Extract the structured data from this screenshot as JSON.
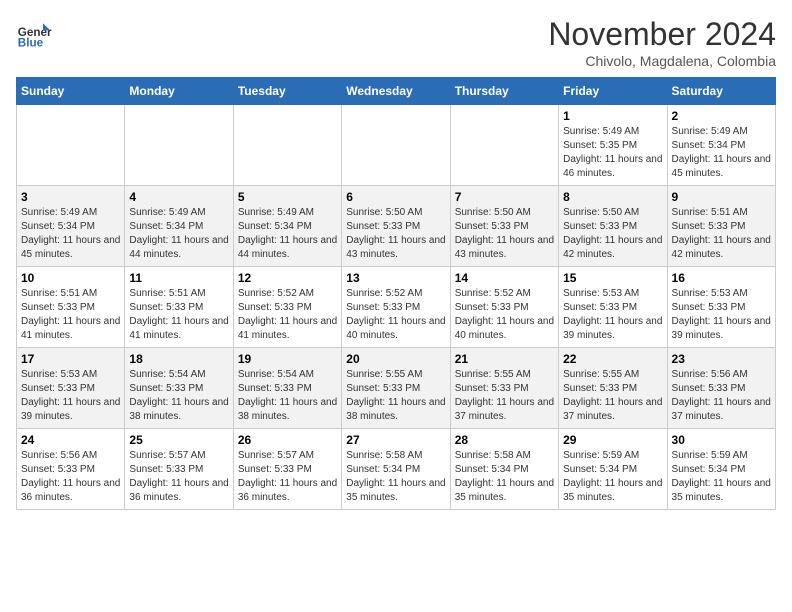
{
  "header": {
    "logo_general": "General",
    "logo_blue": "Blue",
    "month_title": "November 2024",
    "location": "Chivolo, Magdalena, Colombia"
  },
  "calendar": {
    "days_of_week": [
      "Sunday",
      "Monday",
      "Tuesday",
      "Wednesday",
      "Thursday",
      "Friday",
      "Saturday"
    ],
    "weeks": [
      [
        {
          "day": "",
          "info": ""
        },
        {
          "day": "",
          "info": ""
        },
        {
          "day": "",
          "info": ""
        },
        {
          "day": "",
          "info": ""
        },
        {
          "day": "",
          "info": ""
        },
        {
          "day": "1",
          "info": "Sunrise: 5:49 AM\nSunset: 5:35 PM\nDaylight: 11 hours and 46 minutes."
        },
        {
          "day": "2",
          "info": "Sunrise: 5:49 AM\nSunset: 5:34 PM\nDaylight: 11 hours and 45 minutes."
        }
      ],
      [
        {
          "day": "3",
          "info": "Sunrise: 5:49 AM\nSunset: 5:34 PM\nDaylight: 11 hours and 45 minutes."
        },
        {
          "day": "4",
          "info": "Sunrise: 5:49 AM\nSunset: 5:34 PM\nDaylight: 11 hours and 44 minutes."
        },
        {
          "day": "5",
          "info": "Sunrise: 5:49 AM\nSunset: 5:34 PM\nDaylight: 11 hours and 44 minutes."
        },
        {
          "day": "6",
          "info": "Sunrise: 5:50 AM\nSunset: 5:33 PM\nDaylight: 11 hours and 43 minutes."
        },
        {
          "day": "7",
          "info": "Sunrise: 5:50 AM\nSunset: 5:33 PM\nDaylight: 11 hours and 43 minutes."
        },
        {
          "day": "8",
          "info": "Sunrise: 5:50 AM\nSunset: 5:33 PM\nDaylight: 11 hours and 42 minutes."
        },
        {
          "day": "9",
          "info": "Sunrise: 5:51 AM\nSunset: 5:33 PM\nDaylight: 11 hours and 42 minutes."
        }
      ],
      [
        {
          "day": "10",
          "info": "Sunrise: 5:51 AM\nSunset: 5:33 PM\nDaylight: 11 hours and 41 minutes."
        },
        {
          "day": "11",
          "info": "Sunrise: 5:51 AM\nSunset: 5:33 PM\nDaylight: 11 hours and 41 minutes."
        },
        {
          "day": "12",
          "info": "Sunrise: 5:52 AM\nSunset: 5:33 PM\nDaylight: 11 hours and 41 minutes."
        },
        {
          "day": "13",
          "info": "Sunrise: 5:52 AM\nSunset: 5:33 PM\nDaylight: 11 hours and 40 minutes."
        },
        {
          "day": "14",
          "info": "Sunrise: 5:52 AM\nSunset: 5:33 PM\nDaylight: 11 hours and 40 minutes."
        },
        {
          "day": "15",
          "info": "Sunrise: 5:53 AM\nSunset: 5:33 PM\nDaylight: 11 hours and 39 minutes."
        },
        {
          "day": "16",
          "info": "Sunrise: 5:53 AM\nSunset: 5:33 PM\nDaylight: 11 hours and 39 minutes."
        }
      ],
      [
        {
          "day": "17",
          "info": "Sunrise: 5:53 AM\nSunset: 5:33 PM\nDaylight: 11 hours and 39 minutes."
        },
        {
          "day": "18",
          "info": "Sunrise: 5:54 AM\nSunset: 5:33 PM\nDaylight: 11 hours and 38 minutes."
        },
        {
          "day": "19",
          "info": "Sunrise: 5:54 AM\nSunset: 5:33 PM\nDaylight: 11 hours and 38 minutes."
        },
        {
          "day": "20",
          "info": "Sunrise: 5:55 AM\nSunset: 5:33 PM\nDaylight: 11 hours and 38 minutes."
        },
        {
          "day": "21",
          "info": "Sunrise: 5:55 AM\nSunset: 5:33 PM\nDaylight: 11 hours and 37 minutes."
        },
        {
          "day": "22",
          "info": "Sunrise: 5:55 AM\nSunset: 5:33 PM\nDaylight: 11 hours and 37 minutes."
        },
        {
          "day": "23",
          "info": "Sunrise: 5:56 AM\nSunset: 5:33 PM\nDaylight: 11 hours and 37 minutes."
        }
      ],
      [
        {
          "day": "24",
          "info": "Sunrise: 5:56 AM\nSunset: 5:33 PM\nDaylight: 11 hours and 36 minutes."
        },
        {
          "day": "25",
          "info": "Sunrise: 5:57 AM\nSunset: 5:33 PM\nDaylight: 11 hours and 36 minutes."
        },
        {
          "day": "26",
          "info": "Sunrise: 5:57 AM\nSunset: 5:33 PM\nDaylight: 11 hours and 36 minutes."
        },
        {
          "day": "27",
          "info": "Sunrise: 5:58 AM\nSunset: 5:34 PM\nDaylight: 11 hours and 35 minutes."
        },
        {
          "day": "28",
          "info": "Sunrise: 5:58 AM\nSunset: 5:34 PM\nDaylight: 11 hours and 35 minutes."
        },
        {
          "day": "29",
          "info": "Sunrise: 5:59 AM\nSunset: 5:34 PM\nDaylight: 11 hours and 35 minutes."
        },
        {
          "day": "30",
          "info": "Sunrise: 5:59 AM\nSunset: 5:34 PM\nDaylight: 11 hours and 35 minutes."
        }
      ]
    ]
  }
}
